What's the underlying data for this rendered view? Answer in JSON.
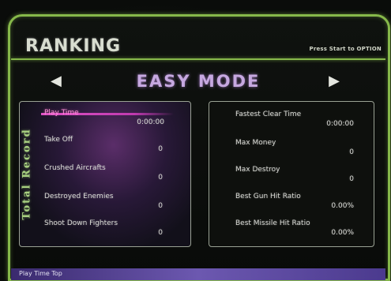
{
  "header": {
    "title": "RANKING",
    "hint": "Press Start to OPTION"
  },
  "mode": {
    "label": "EASY MODE",
    "prev_icon": "triangle-left-icon",
    "next_icon": "triangle-right-icon"
  },
  "section_label": "Total Record",
  "left_stats": [
    {
      "label": "Play Time",
      "value": "0:00:00"
    },
    {
      "label": "Take Off",
      "value": "0"
    },
    {
      "label": "Crushed Aircrafts",
      "value": "0"
    },
    {
      "label": "Destroyed Enemies",
      "value": "0"
    },
    {
      "label": "Shoot Down Fighters",
      "value": "0"
    }
  ],
  "right_stats": [
    {
      "label": "Fastest Clear Time",
      "value": "0:00:00"
    },
    {
      "label": "Max Money",
      "value": "0"
    },
    {
      "label": "Max Destroy",
      "value": "0"
    },
    {
      "label": "Best Gun Hit Ratio",
      "value": "0.00%"
    },
    {
      "label": "Best Missile Hit Ratio",
      "value": "0.00%"
    }
  ],
  "footer": {
    "text": "Play Time Top"
  },
  "colors": {
    "frame_green": "#86b84a",
    "mode_purple": "#c6a8e0",
    "highlight_pink": "#e054c6"
  }
}
